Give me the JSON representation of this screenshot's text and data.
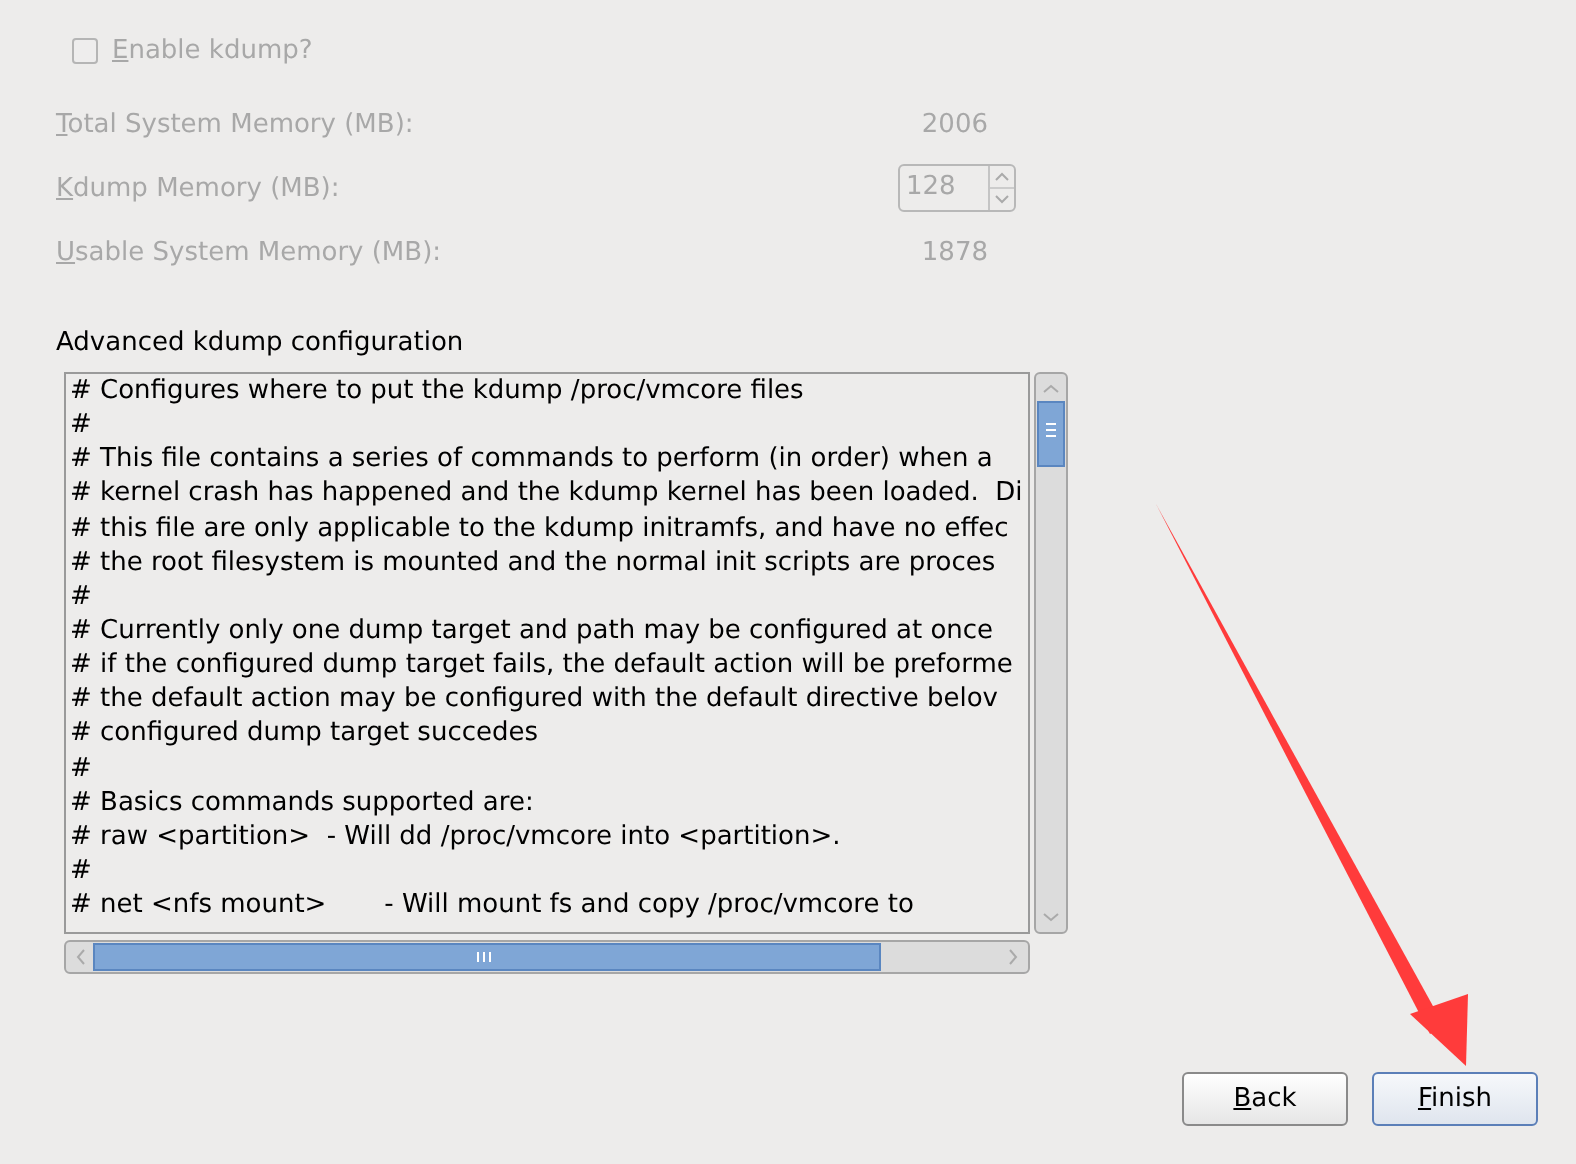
{
  "enable_kdump": {
    "label": "Enable kdump?",
    "checked": false,
    "disabled": true
  },
  "memory": [
    {
      "kind": "readout",
      "label": "Total System Memory (MB):",
      "value": "2006",
      "disabled": true
    },
    {
      "kind": "spinner",
      "label": "Kdump Memory (MB):",
      "value": "128",
      "disabled": true
    },
    {
      "kind": "readout",
      "label": "Usable System Memory (MB):",
      "value": "1878",
      "disabled": true
    }
  ],
  "advanced": {
    "label": "Advanced kdump configuration",
    "lines": [
      "# Configures where to put the kdump /proc/vmcore files",
      "#",
      "# This file contains a series of commands to perform (in order) when a",
      "# kernel crash has happened and the kdump kernel has been loaded.  Di",
      "# this file are only applicable to the kdump initramfs, and have no effec",
      "# the root filesystem is mounted and the normal init scripts are proces",
      "#",
      "# Currently only one dump target and path may be configured at once",
      "# if the configured dump target fails, the default action will be preforme",
      "# the default action may be configured with the default directive belov",
      "# configured dump target succedes",
      "#",
      "# Basics commands supported are:",
      "# raw <partition>  - Will dd /proc/vmcore into <partition>.",
      "#",
      "# net <nfs mount>       - Will mount fs and copy /proc/vmcore to"
    ]
  },
  "buttons": [
    {
      "label": "Back",
      "focused": false
    },
    {
      "label": "Finish",
      "focused": true
    }
  ]
}
